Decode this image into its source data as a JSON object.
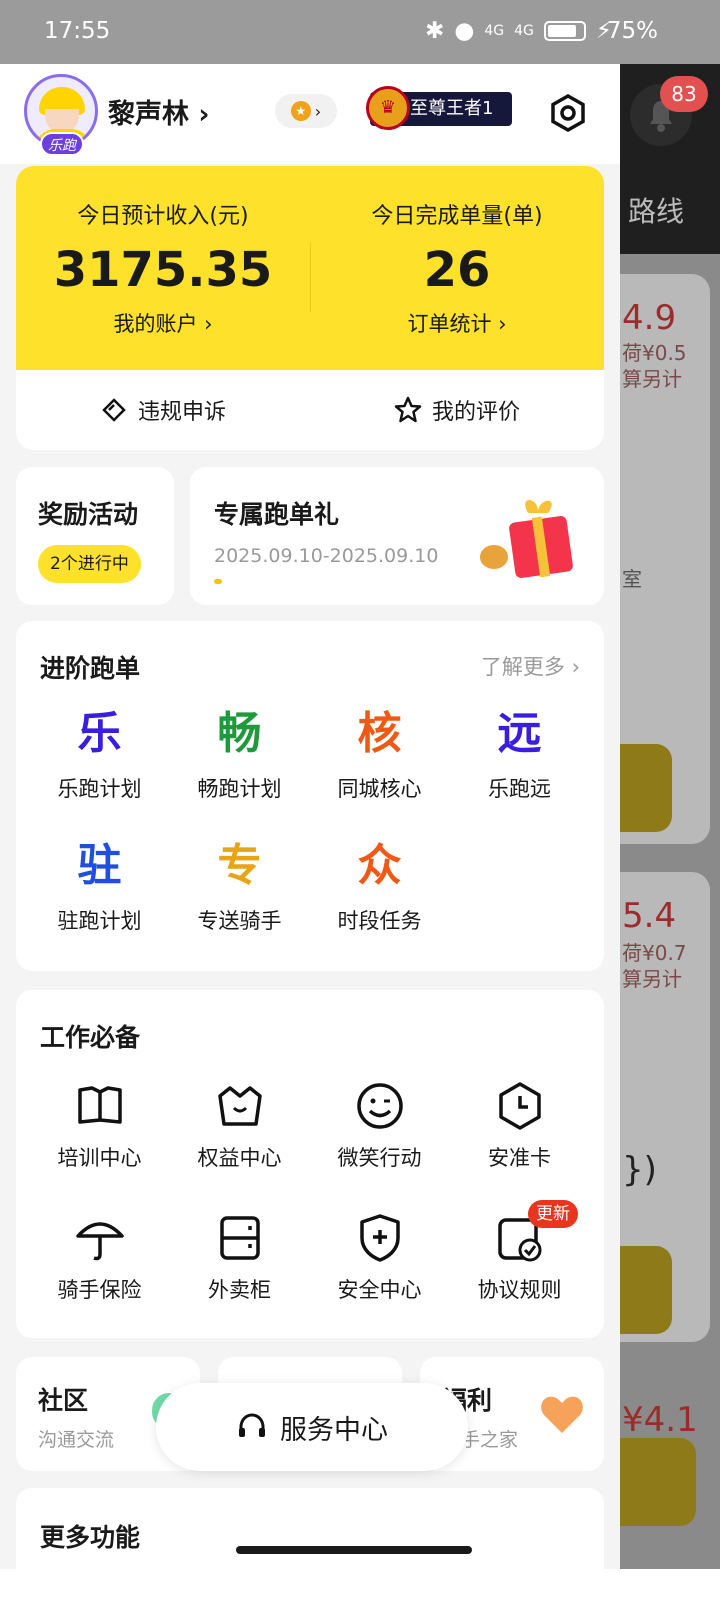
{
  "status_bar": {
    "time": "17:55",
    "network1": "4G",
    "network2": "4G",
    "battery": "75%"
  },
  "background": {
    "route_label": "路线",
    "badge_count": "83",
    "price1": "4.9",
    "price1_sub": "荷¥0.5",
    "price1_sub2": "算另计",
    "room_text": "室",
    "price2": "5.4",
    "price2_sub": "荷¥0.7",
    "price2_sub2": "算另计",
    "paren": "})",
    "price3": "¥4.1"
  },
  "profile": {
    "name": "黎声林",
    "chevron": "›",
    "avatar_tag": "乐跑",
    "rank_label": "至尊王者1"
  },
  "income": {
    "left_label": "今日预计收入(元)",
    "left_value": "3175.35",
    "left_link": "我的账户 ›",
    "right_label": "今日完成单量(单)",
    "right_value": "26",
    "right_link": "订单统计 ›",
    "appeal": "违规申诉",
    "rating": "我的评价"
  },
  "rewards": {
    "title": "奖励活动",
    "tag": "2个进行中",
    "promo_title": "专属跑单礼",
    "promo_dates": "2025.09.10-2025.09.10"
  },
  "advanced": {
    "title": "进阶跑单",
    "more": "了解更多 ›",
    "items": [
      {
        "glyph": "乐",
        "label": "乐跑计划",
        "color": "#3a1ee0"
      },
      {
        "glyph": "畅",
        "label": "畅跑计划",
        "color": "#1e9a3c"
      },
      {
        "glyph": "核",
        "label": "同城核心",
        "color": "#ee5a16"
      },
      {
        "glyph": "远",
        "label": "乐跑远",
        "color": "#3a1ee0"
      },
      {
        "glyph": "驻",
        "label": "驻跑计划",
        "color": "#1f4fdc"
      },
      {
        "glyph": "专",
        "label": "专送骑手",
        "color": "#e8a316"
      },
      {
        "glyph": "众",
        "label": "时段任务",
        "color": "#ee5a16"
      }
    ]
  },
  "work": {
    "title": "工作必备",
    "items": [
      {
        "label": "培训中心",
        "icon": "book-icon"
      },
      {
        "label": "权益中心",
        "icon": "crown-icon"
      },
      {
        "label": "微笑行动",
        "icon": "smile-icon"
      },
      {
        "label": "安准卡",
        "icon": "clock-icon"
      },
      {
        "label": "骑手保险",
        "icon": "umbrella-icon"
      },
      {
        "label": "外卖柜",
        "icon": "locker-icon"
      },
      {
        "label": "安全中心",
        "icon": "shield-icon"
      },
      {
        "label": "协议规则",
        "icon": "document-check-icon"
      }
    ],
    "new_badge": "更新"
  },
  "bottom": {
    "community_title": "社区",
    "community_sub": "沟通交流",
    "welfare_title": "福利",
    "welfare_sub": "骑手之家",
    "service": "服务中心",
    "more_title": "更多功能"
  }
}
